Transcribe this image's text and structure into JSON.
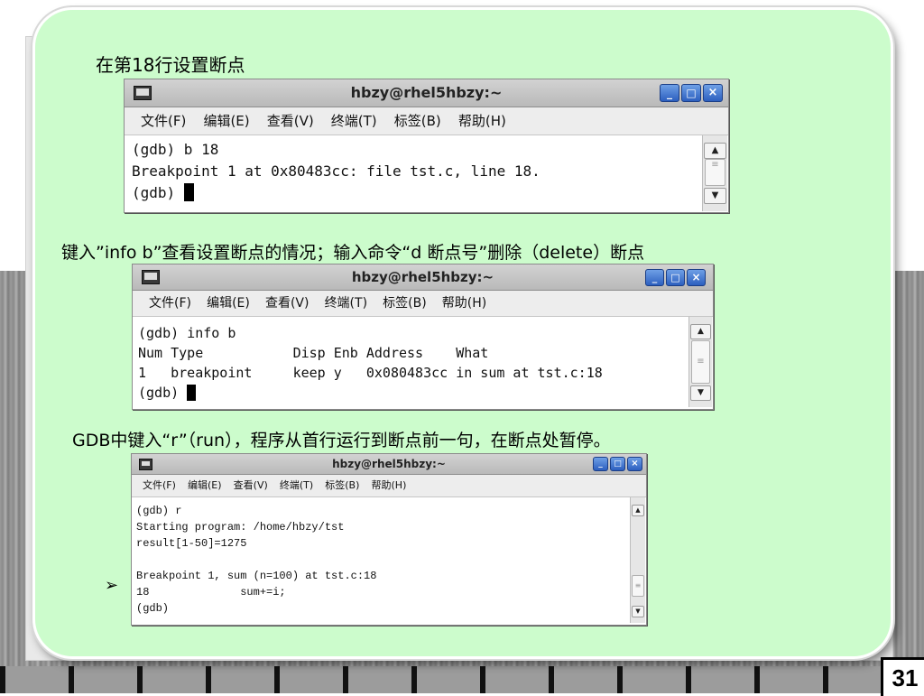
{
  "slide": {
    "caption1": "在第18行设置断点",
    "caption2": "键入”info b”查看设置断点的情况；输入命令“d 断点号”删除（delete）断点",
    "caption3": "GDB中键入“r”（run），程序从首行运行到断点前一句，在断点处暂停。",
    "bullet": "➢",
    "page_number": "31"
  },
  "windows": [
    {
      "title": "hbzy@rhel5hbzy:~",
      "menu": [
        "文件(F)",
        "编辑(E)",
        "查看(V)",
        "终端(T)",
        "标签(B)",
        "帮助(H)"
      ],
      "lines": [
        "(gdb) b 18",
        "Breakpoint 1 at 0x80483cc: file tst.c, line 18.",
        "(gdb) "
      ]
    },
    {
      "title": "hbzy@rhel5hbzy:~",
      "menu": [
        "文件(F)",
        "编辑(E)",
        "查看(V)",
        "终端(T)",
        "标签(B)",
        "帮助(H)"
      ],
      "lines": [
        "(gdb) info b",
        "Num Type           Disp Enb Address    What",
        "1   breakpoint     keep y   0x080483cc in sum at tst.c:18",
        "(gdb) "
      ]
    },
    {
      "title": "hbzy@rhel5hbzy:~",
      "menu": [
        "文件(F)",
        "编辑(E)",
        "查看(V)",
        "终端(T)",
        "标签(B)",
        "帮助(H)"
      ],
      "lines": [
        "(gdb) r",
        "Starting program: /home/hbzy/tst",
        "result[1-50]=1275",
        "",
        "Breakpoint 1, sum (n=100) at tst.c:18",
        "18              sum+=i;",
        "(gdb)"
      ]
    }
  ],
  "window_buttons": [
    "_",
    "□",
    "×"
  ],
  "scroll_arrows": {
    "up": "▲",
    "down": "▼"
  }
}
